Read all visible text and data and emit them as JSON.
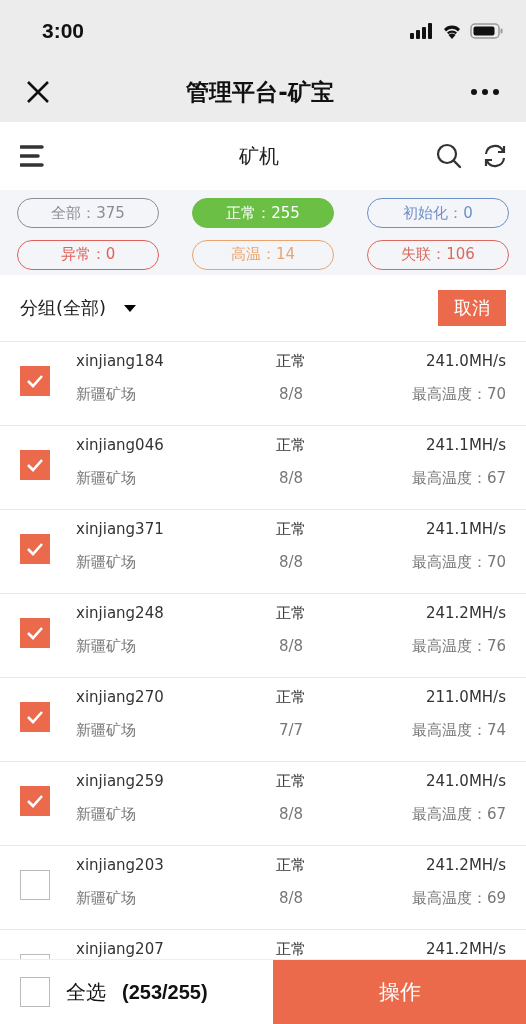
{
  "status_bar": {
    "time": "3:00"
  },
  "nav": {
    "title": "管理平台-矿宝"
  },
  "header": {
    "title": "矿机"
  },
  "filters": [
    {
      "label": "全部：375",
      "color": "#8c8c99",
      "selected": false
    },
    {
      "label": "正常：255",
      "color": "#6cbf45",
      "selected": true
    },
    {
      "label": "初始化：0",
      "color": "#6f8fc8",
      "selected": false
    },
    {
      "label": "异常：0",
      "color": "#e0605a",
      "selected": false
    },
    {
      "label": "高温：14",
      "color": "#eba46c",
      "selected": false
    },
    {
      "label": "失联：106",
      "color": "#d96a5e",
      "selected": false
    }
  ],
  "group": {
    "label": "分组(全部)",
    "cancel": "取消"
  },
  "rows": [
    {
      "name": "xinjiang184",
      "status": "正常",
      "hashrate": "241.0MH/s",
      "farm": "新疆矿场",
      "boards": "8/8",
      "temp": "最高温度：70",
      "checked": true
    },
    {
      "name": "xinjiang046",
      "status": "正常",
      "hashrate": "241.1MH/s",
      "farm": "新疆矿场",
      "boards": "8/8",
      "temp": "最高温度：67",
      "checked": true
    },
    {
      "name": "xinjiang371",
      "status": "正常",
      "hashrate": "241.1MH/s",
      "farm": "新疆矿场",
      "boards": "8/8",
      "temp": "最高温度：70",
      "checked": true
    },
    {
      "name": "xinjiang248",
      "status": "正常",
      "hashrate": "241.2MH/s",
      "farm": "新疆矿场",
      "boards": "8/8",
      "temp": "最高温度：76",
      "checked": true
    },
    {
      "name": "xinjiang270",
      "status": "正常",
      "hashrate": "211.0MH/s",
      "farm": "新疆矿场",
      "boards": "7/7",
      "temp": "最高温度：74",
      "checked": true
    },
    {
      "name": "xinjiang259",
      "status": "正常",
      "hashrate": "241.0MH/s",
      "farm": "新疆矿场",
      "boards": "8/8",
      "temp": "最高温度：67",
      "checked": true
    },
    {
      "name": "xinjiang203",
      "status": "正常",
      "hashrate": "241.2MH/s",
      "farm": "新疆矿场",
      "boards": "8/8",
      "temp": "最高温度：69",
      "checked": false
    },
    {
      "name": "xinjiang207",
      "status": "正常",
      "hashrate": "241.2MH/s",
      "checked": false
    }
  ],
  "footer": {
    "select_all": "全选",
    "count": "(253/255)",
    "select_all_checked": false,
    "action": "操作"
  }
}
